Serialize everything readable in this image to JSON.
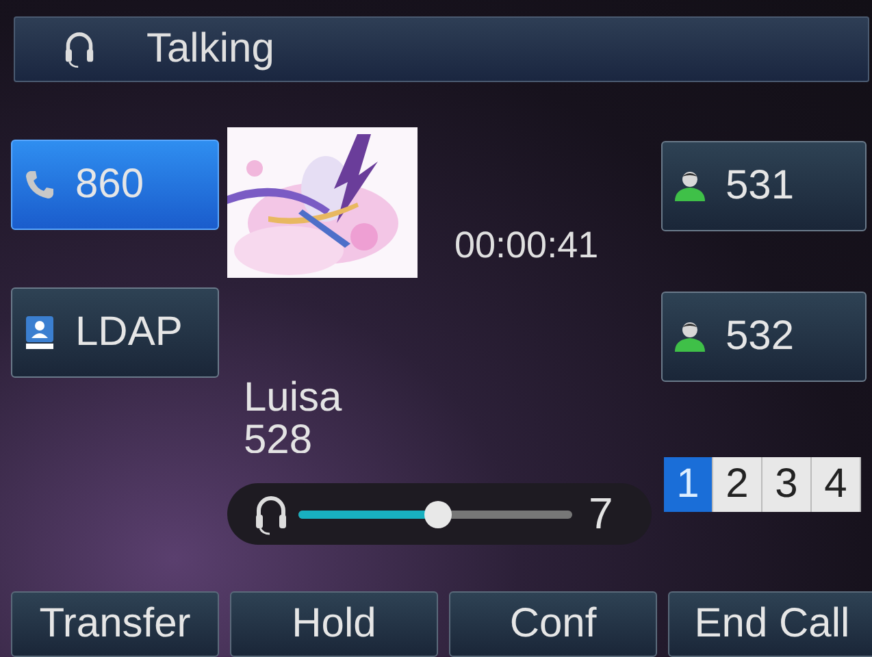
{
  "title_bar": {
    "title": "Talking"
  },
  "left_keys": [
    {
      "kind": "line",
      "label": "860",
      "selected": true
    },
    {
      "kind": "directory",
      "label": "LDAP",
      "selected": false
    }
  ],
  "caller": {
    "duration": "00:00:41",
    "name": "Luisa",
    "number": "528"
  },
  "right_keys": [
    {
      "kind": "contact",
      "label": "531"
    },
    {
      "kind": "contact",
      "label": "532"
    }
  ],
  "volume": {
    "level": 0.51,
    "reading": "7"
  },
  "line_pages": [
    {
      "label": "1",
      "selected": true
    },
    {
      "label": "2",
      "selected": false
    },
    {
      "label": "3",
      "selected": false
    },
    {
      "label": "4",
      "selected": false
    }
  ],
  "soft_keys": [
    "Transfer",
    "Hold",
    "Conf",
    "End Call"
  ]
}
